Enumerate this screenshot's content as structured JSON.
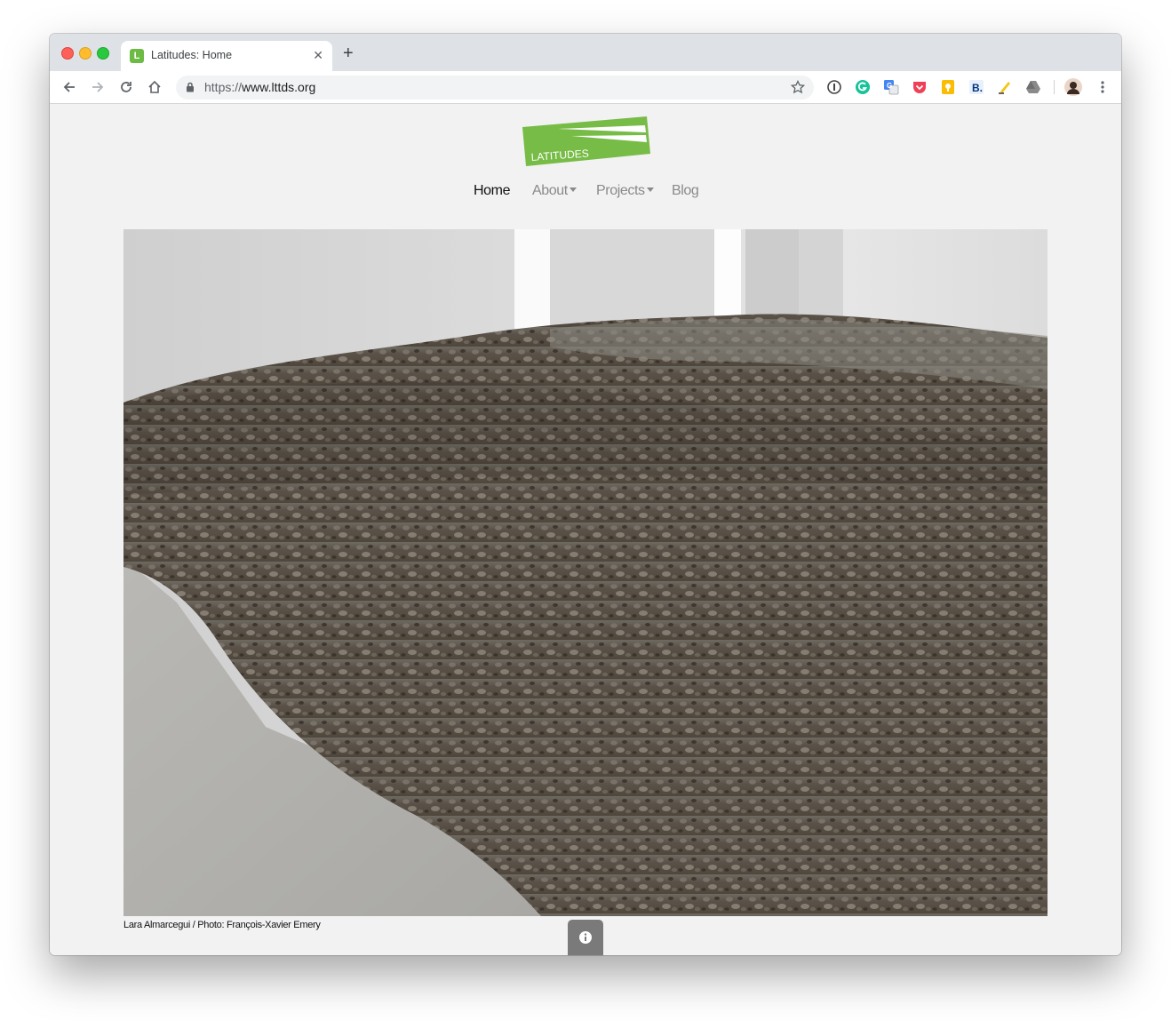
{
  "browser": {
    "tab": {
      "title": "Latitudes: Home",
      "favicon_letter": "L",
      "close_glyph": "✕"
    },
    "new_tab_glyph": "+",
    "url": {
      "scheme": "https://",
      "host": "www.lttds.org"
    },
    "extensions": [
      "1password-icon",
      "grammarly-icon",
      "google-translate-icon",
      "pocket-icon",
      "keep-icon",
      "b-extension-icon",
      "highlighter-icon",
      "drive-icon"
    ]
  },
  "site": {
    "logo_text": "LATITUDES",
    "brand_color": "#77bc46",
    "nav": {
      "home": "Home",
      "about": "About",
      "projects": "Projects",
      "blog": "Blog"
    },
    "hero": {
      "caption": "Lara Almarcegui / Photo: François-Xavier Emery"
    }
  }
}
